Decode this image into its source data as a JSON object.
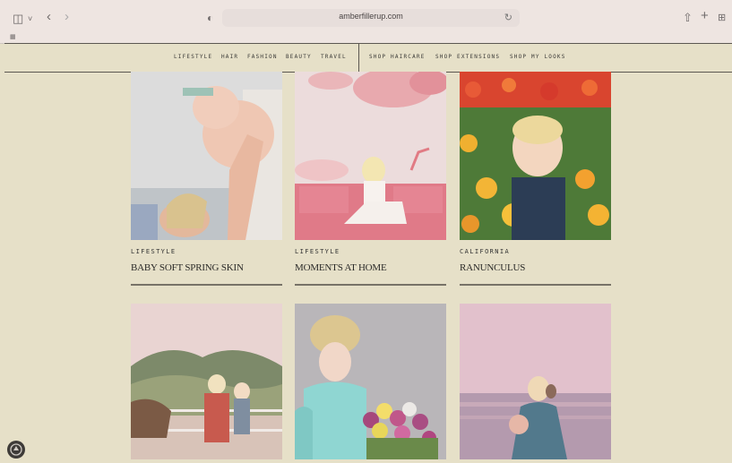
{
  "browser": {
    "url": "amberfillerup.com"
  },
  "nav": {
    "left": [
      "LIFESTYLE",
      "HAIR",
      "FASHION",
      "BEAUTY",
      "TRAVEL"
    ],
    "right": [
      "SHOP HAIRCARE",
      "SHOP EXTENSIONS",
      "SHOP MY LOOKS"
    ]
  },
  "posts": [
    {
      "category": "LIFESTYLE",
      "title": "BABY SOFT SPRING SKIN"
    },
    {
      "category": "LIFESTYLE",
      "title": "MOMENTS AT HOME"
    },
    {
      "category": "CALIFORNIA",
      "title": "RANUNCULUS"
    },
    {
      "category": "",
      "title": ""
    },
    {
      "category": "",
      "title": ""
    },
    {
      "category": "",
      "title": ""
    }
  ]
}
